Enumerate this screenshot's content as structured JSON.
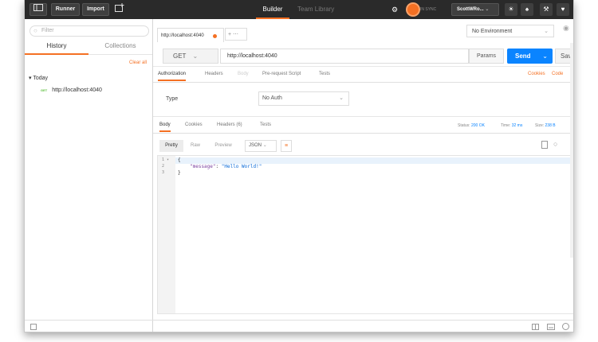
{
  "topbar": {
    "runner": "Runner",
    "import": "Import",
    "tab_builder": "Builder",
    "tab_team_library": "Team Library",
    "sync_status": "IN SYNC",
    "user": "ScottWRo..."
  },
  "sidebar": {
    "filter_placeholder": "Filter",
    "tabs": [
      {
        "label": "History"
      },
      {
        "label": "Collections"
      }
    ],
    "clear_all": "Clear all",
    "group_label": "Today",
    "items": [
      {
        "method": "GET",
        "url": "http://localhost:4040"
      }
    ]
  },
  "request": {
    "tab_title": "http://localhost:4040",
    "environment": "No Environment",
    "method": "GET",
    "url": "http://localhost:4040",
    "params": "Params",
    "send": "Send",
    "save": "Save",
    "tabs": [
      "Authorization",
      "Headers",
      "Body",
      "Pre-request Script",
      "Tests"
    ],
    "cookies": "Cookies",
    "code": "Code",
    "auth_type_label": "Type",
    "auth_type_value": "No Auth"
  },
  "response": {
    "tabs": [
      "Body",
      "Cookies",
      "Headers (6)",
      "Tests"
    ],
    "status_label": "Status:",
    "status_value": "200 OK",
    "time_label": "Time:",
    "time_value": "32 ms",
    "size_label": "Size:",
    "size_value": "238 B",
    "view_modes": [
      "Pretty",
      "Raw",
      "Preview"
    ],
    "format": "JSON",
    "lines": [
      {
        "num": "1",
        "text": "{"
      },
      {
        "num": "2",
        "key": "\"message\"",
        "sep": ": ",
        "value": "\"Hello World!\""
      },
      {
        "num": "3",
        "text": "}"
      }
    ]
  },
  "colors": {
    "accent": "#f47023",
    "send": "#0a84ff",
    "topbar": "#2a2a2a"
  }
}
